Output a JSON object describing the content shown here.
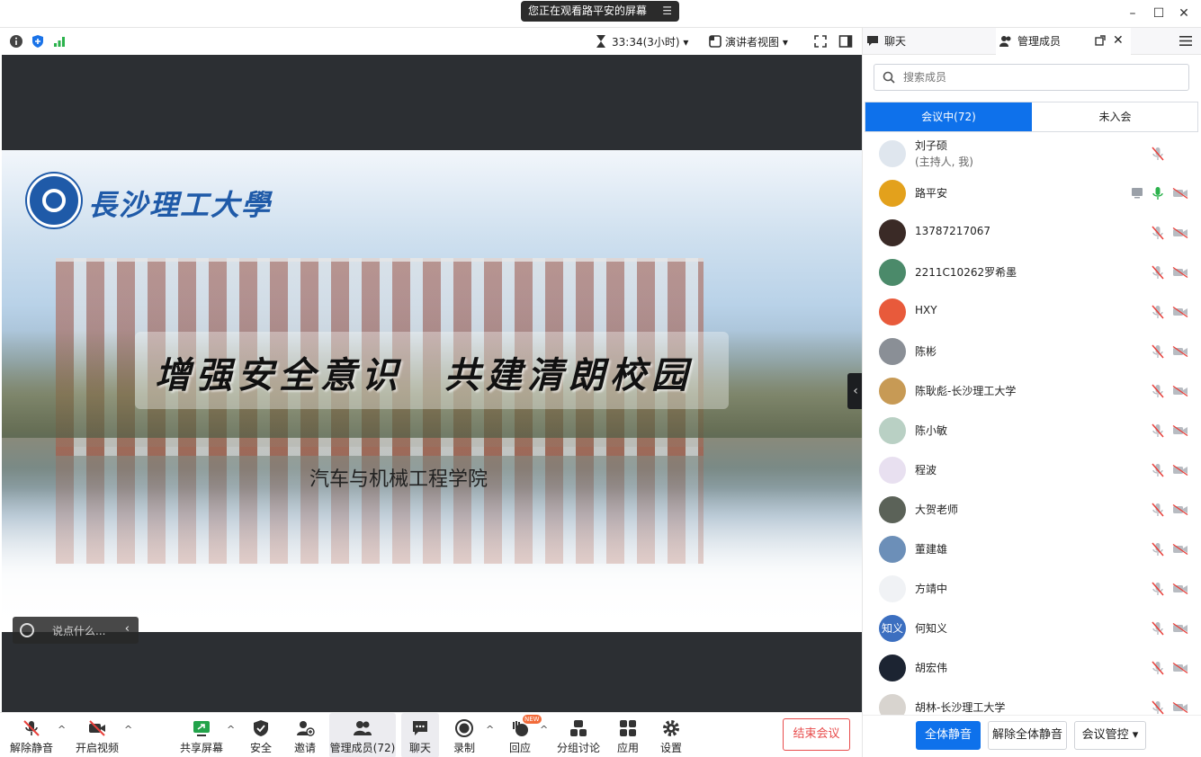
{
  "window": {
    "share_notice": "您正在观看路平安的屏幕",
    "minimize_icon": "minimize-icon",
    "maximize_icon": "maximize-icon",
    "close_icon": "close-icon"
  },
  "topbar": {
    "timer": "33:34(3小时)",
    "view_mode": "演讲者视图"
  },
  "slide": {
    "university": "長沙理工大學",
    "slogan": "增强安全意识　共建清朗校园",
    "college": "汽车与机械工程学院"
  },
  "reaction": {
    "placeholder": "说点什么..."
  },
  "toolbar": {
    "mute": "解除静音",
    "video": "开启视频",
    "share": "共享屏幕",
    "security": "安全",
    "invite": "邀请",
    "participants": "管理成员(72)",
    "chat": "聊天",
    "record": "录制",
    "reactions": "回应",
    "new_badge": "NEW",
    "breakout": "分组讨论",
    "apps": "应用",
    "settings": "设置",
    "end": "结束会议"
  },
  "panel": {
    "tab_chat": "聊天",
    "tab_members": "管理成员",
    "search_placeholder": "搜索成员",
    "seg_in": "会议中(72)",
    "seg_out": "未入会",
    "mute_all": "全体静音",
    "unmute_all": "解除全体静音",
    "controls": "会议管控"
  },
  "members": [
    {
      "name": "刘子硕",
      "sub": "(主持人, 我)",
      "avatar_color": "#dfe6ee",
      "avatar_text": ""
    },
    {
      "name": "路平安",
      "avatar_color": "#e3a11c",
      "avatar_text": "",
      "sharing": true
    },
    {
      "name": "13787217067",
      "avatar_color": "#3a2a26",
      "avatar_text": ""
    },
    {
      "name": "2211C10262罗希墨",
      "avatar_color": "#4b8a6a",
      "avatar_text": ""
    },
    {
      "name": "HXY",
      "avatar_color": "#e85a3b",
      "avatar_text": ""
    },
    {
      "name": "陈彬",
      "avatar_color": "#8a8f96",
      "avatar_text": ""
    },
    {
      "name": "陈耿彪-长沙理工大学",
      "avatar_color": "#c79a55",
      "avatar_text": ""
    },
    {
      "name": "陈小敏",
      "avatar_color": "#b9d0c4",
      "avatar_text": ""
    },
    {
      "name": "程波",
      "avatar_color": "#e8e0f0",
      "avatar_text": ""
    },
    {
      "name": "大贺老师",
      "avatar_color": "#5b6258",
      "avatar_text": ""
    },
    {
      "name": "董建雄",
      "avatar_color": "#6c8fb8",
      "avatar_text": ""
    },
    {
      "name": "方靖中",
      "avatar_color": "#f0f2f5",
      "avatar_text": ""
    },
    {
      "name": "何知义",
      "avatar_color": "#3c6fc0",
      "avatar_text": "知义"
    },
    {
      "name": "胡宏伟",
      "avatar_color": "#1c2432",
      "avatar_text": ""
    },
    {
      "name": "胡林-长沙理工大学",
      "avatar_color": "#d8d4cf",
      "avatar_text": ""
    }
  ]
}
